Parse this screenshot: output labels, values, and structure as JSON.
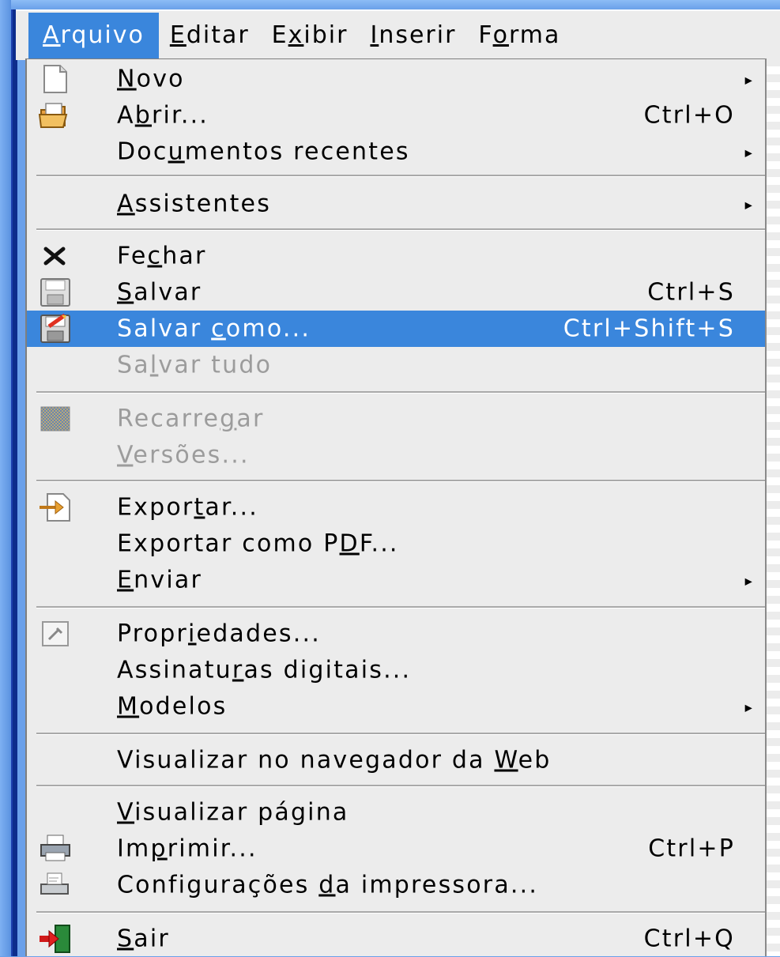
{
  "menubar": {
    "items": [
      {
        "pre": "",
        "u": "A",
        "post": "rquivo"
      },
      {
        "pre": "",
        "u": "E",
        "post": "ditar"
      },
      {
        "pre": "E",
        "u": "x",
        "post": "ibir"
      },
      {
        "pre": "",
        "u": "I",
        "post": "nserir"
      },
      {
        "pre": "F",
        "u": "o",
        "post": "rma"
      }
    ]
  },
  "menu": {
    "novo": {
      "pre": "",
      "u": "N",
      "post": "ovo"
    },
    "abrir": {
      "pre": "A",
      "u": "b",
      "post": "rir...",
      "shortcut": "Ctrl+O"
    },
    "recentes": {
      "pre": "Doc",
      "u": "u",
      "post": "mentos recentes"
    },
    "assistentes": {
      "pre": "",
      "u": "A",
      "post": "ssistentes"
    },
    "fechar": {
      "pre": "Fe",
      "u": "c",
      "post": "har"
    },
    "salvar": {
      "pre": "",
      "u": "S",
      "post": "alvar",
      "shortcut": "Ctrl+S"
    },
    "salvar_como": {
      "pre": "Salvar ",
      "u": "c",
      "post": "omo...",
      "shortcut": "Ctrl+Shift+S"
    },
    "salvar_tudo": {
      "pre": "Sa",
      "u": "l",
      "post": "var tudo"
    },
    "recarregar": {
      "pre": "Recarre",
      "u": "g",
      "post": "ar"
    },
    "versoes": {
      "pre": "",
      "u": "V",
      "post": "ersões..."
    },
    "exportar": {
      "pre": "Expor",
      "u": "t",
      "post": "ar..."
    },
    "exportar_pdf": {
      "pre": "Exportar como P",
      "u": "D",
      "post": "F..."
    },
    "enviar": {
      "pre": "",
      "u": "E",
      "post": "nviar"
    },
    "propriedades": {
      "pre": "Propr",
      "u": "i",
      "post": "edades..."
    },
    "assinaturas": {
      "pre": "Assinatu",
      "u": "r",
      "post": "as digitais..."
    },
    "modelos": {
      "pre": "",
      "u": "M",
      "post": "odelos"
    },
    "visualizar_web": {
      "pre": "Visualizar no navegador da ",
      "u": "W",
      "post": "eb"
    },
    "visualizar_pagina": {
      "pre": "",
      "u": "V",
      "post": "isualizar página"
    },
    "imprimir": {
      "pre": "Im",
      "u": "p",
      "post": "rimir...",
      "shortcut": "Ctrl+P"
    },
    "config_impressora": {
      "pre": "Configurações ",
      "u": "d",
      "post": "a impressora..."
    },
    "sair": {
      "pre": "",
      "u": "S",
      "post": "air",
      "shortcut": "Ctrl+Q"
    }
  },
  "icons": {
    "novo": "new-document-icon",
    "abrir": "open-folder-icon",
    "fechar": "close-icon",
    "salvar": "save-disk-icon",
    "salvar_como": "save-as-icon",
    "recarregar": "reload-icon",
    "exportar": "export-icon",
    "propriedades": "properties-icon",
    "imprimir": "printer-icon",
    "config_impressora": "printer-settings-icon",
    "sair": "exit-icon"
  },
  "colors": {
    "highlight": "#3a86dc",
    "menu_bg": "#ececec",
    "disabled": "#9c9c9c"
  }
}
